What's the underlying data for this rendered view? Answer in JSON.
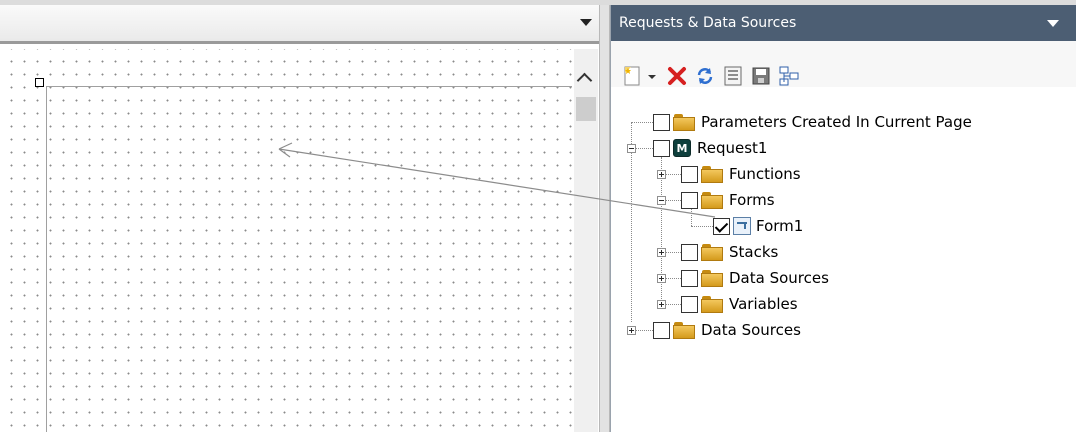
{
  "panel": {
    "title": "Requests & Data Sources",
    "title_bar_color": "#4c5e73"
  },
  "toolbar": {
    "buttons": [
      {
        "name": "new-item-icon"
      },
      {
        "name": "dropdown-arrow-icon"
      },
      {
        "name": "delete-icon"
      },
      {
        "name": "refresh-icon"
      },
      {
        "name": "properties-icon"
      },
      {
        "name": "save-icon"
      },
      {
        "name": "structure-icon"
      }
    ]
  },
  "tree": {
    "parameters": "Parameters Created In Current Page",
    "request": "Request1",
    "functions": "Functions",
    "forms": "Forms",
    "form1": "Form1",
    "stacks": "Stacks",
    "data_sources_child": "Data Sources",
    "variables": "Variables",
    "data_sources_root": "Data Sources"
  },
  "state": {
    "form1_checked": true
  }
}
